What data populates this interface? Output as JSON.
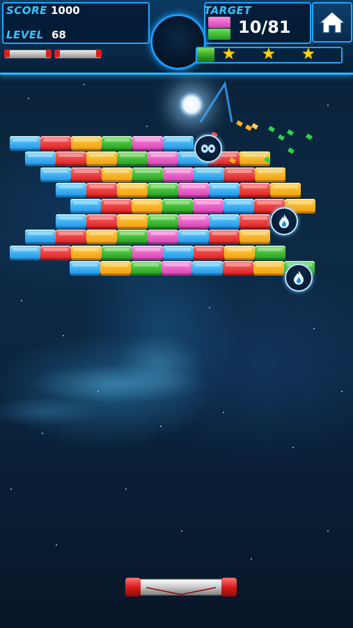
{
  "hud": {
    "score_label": "SCORE",
    "score_value": "1000",
    "level_label": "LEVEL",
    "level_value": "68",
    "target_label": "TARGET",
    "target_count": "10/81",
    "target_progress_fraction": 0.123,
    "stars_earned": 3,
    "lives": 2,
    "home_icon": "home-icon"
  },
  "bricks": [
    [
      "blue",
      "red",
      "orange",
      "green",
      "pink",
      "blue"
    ],
    [
      "blue",
      "red",
      "orange",
      "green",
      "pink",
      "blue",
      "red",
      "orange"
    ],
    [
      "blue",
      "red",
      "orange",
      "green",
      "pink",
      "blue",
      "red",
      "orange"
    ],
    [
      "blue",
      "red",
      "orange",
      "green",
      "pink",
      "blue",
      "red",
      "orange"
    ],
    [
      "blue",
      "red",
      "orange",
      "green",
      "pink",
      "blue",
      "red",
      "orange"
    ],
    [
      "blue",
      "red",
      "orange",
      "green",
      "pink",
      "blue",
      "red"
    ],
    [
      "blue",
      "red",
      "orange",
      "green",
      "pink",
      "blue",
      "red",
      "orange"
    ],
    [
      "blue",
      "red",
      "orange",
      "green",
      "pink",
      "blue",
      "red",
      "orange",
      "green"
    ],
    [
      "blue",
      "orange",
      "green",
      "pink",
      "blue",
      "red",
      "orange",
      "green"
    ]
  ],
  "colors": {
    "hud_accent": "#1fa6ff",
    "hud_label": "#35c5ff",
    "progress_green": "#4cc02c",
    "star_gold": "#ffd21a"
  },
  "powerups": [
    "skull-orb-icon",
    "flame-orb-icon",
    "flame-orb-icon"
  ]
}
